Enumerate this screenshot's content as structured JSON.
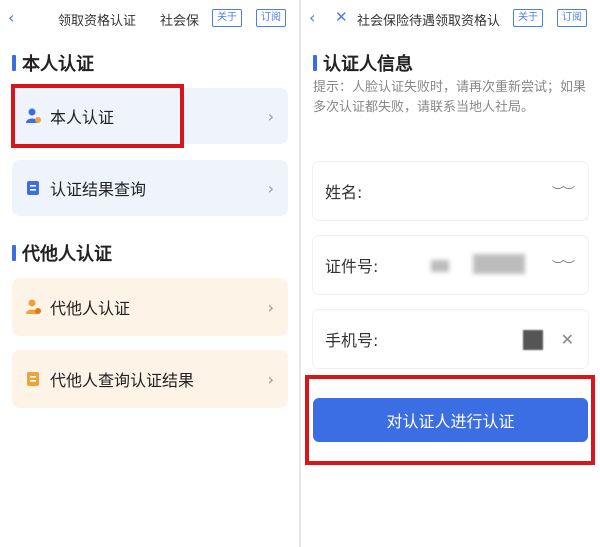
{
  "left": {
    "topbar": {
      "back_icon": "chevron-left-icon",
      "title": "领取资格认证",
      "title2": "社会保",
      "about": "关于",
      "subscribe": "订阅"
    },
    "section1": {
      "title": "本人认证"
    },
    "self_card": {
      "label": "本人认证",
      "icon": "person-icon"
    },
    "result_card": {
      "label": "认证结果查询",
      "icon": "document-icon"
    },
    "section2": {
      "title": "代他人认证"
    },
    "agent_card": {
      "label": "代他人认证",
      "icon": "person-icon"
    },
    "agent_query_card": {
      "label": "代他人查询认证结果",
      "icon": "document-icon"
    }
  },
  "right": {
    "topbar": {
      "back_icon": "chevron-left-icon",
      "close_icon": "close-icon",
      "title": "社会保险待遇领取资格认",
      "about": "关于",
      "subscribe": "订阅"
    },
    "section_title": "认证人信息",
    "tip": "提示：人脸认证失败时，请再次重新尝试；如果多次认证都失败，请联系当地人社局。",
    "fields": [
      {
        "label": "姓名:"
      },
      {
        "label": "证件号:"
      },
      {
        "label": "手机号:"
      }
    ],
    "submit": "对认证人进行认证"
  },
  "colors": {
    "accent": "#3b6ee2",
    "highlight": "#d8151b",
    "card_blue": "#eef3fc",
    "card_orange": "#fdf3e7"
  }
}
